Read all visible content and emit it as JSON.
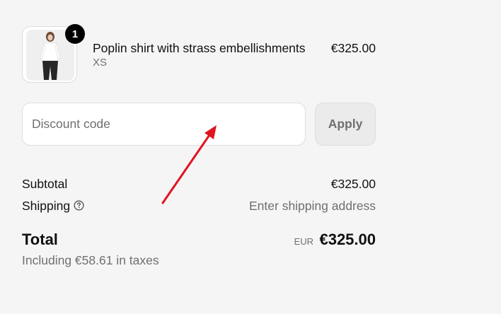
{
  "product": {
    "quantity": "1",
    "name": "Poplin shirt with strass embellishments",
    "variant": "XS",
    "price": "€325.00",
    "thumbnail_icon": "product-photo-shirt"
  },
  "discount": {
    "placeholder": "Discount code",
    "value": "",
    "apply_label": "Apply"
  },
  "summary": {
    "subtotal_label": "Subtotal",
    "subtotal_value": "€325.00",
    "shipping_label": "Shipping",
    "shipping_value": "Enter shipping address",
    "shipping_help_icon": "question-circle-icon",
    "total_label": "Total",
    "total_currency": "EUR",
    "total_value": "€325.00",
    "taxes_note": "Including €58.61 in taxes"
  },
  "annotation": {
    "icon": "red-arrow",
    "color": "#e0141e"
  },
  "colors": {
    "background": "#f5f5f5",
    "muted_text": "#707070",
    "badge": "#000000"
  }
}
